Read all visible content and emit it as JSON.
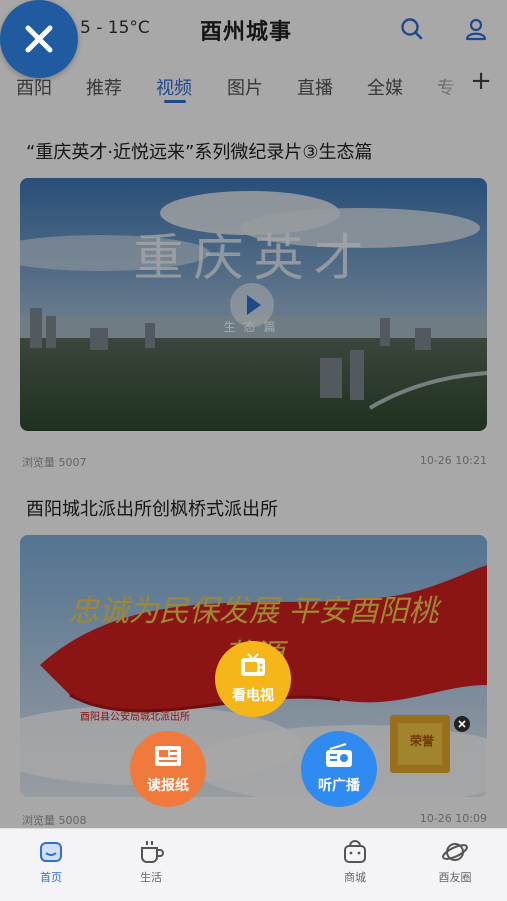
{
  "header": {
    "weather": "5 - 15°C",
    "title": "酉州城事"
  },
  "tabs": [
    {
      "label": "酉阳"
    },
    {
      "label": "推荐"
    },
    {
      "label": "视频"
    },
    {
      "label": "图片"
    },
    {
      "label": "直播"
    },
    {
      "label": "全媒"
    },
    {
      "label": "专"
    }
  ],
  "articles": [
    {
      "title": "“重庆英才·近悦远来”系列微纪录片③生态篇",
      "image_text": "重庆英才",
      "image_subtext": "生态篇",
      "views": "浏览量 5007",
      "time": "10-26 10:21"
    },
    {
      "title": "酉阳城北派出所创枫桥式派出所",
      "image_text": "忠诚为民保发展 平安酉阳桃花源",
      "image_caption": "酉阳县公安局城北派出所",
      "stamp": "荣誉",
      "views": "浏览量 5008",
      "time": "10-26 10:09"
    }
  ],
  "float_menu": {
    "tv": "看电视",
    "newspaper": "读报纸",
    "radio": "听广播"
  },
  "bottom_nav": [
    {
      "label": "首页"
    },
    {
      "label": "生活"
    },
    {
      "label": "商城"
    },
    {
      "label": "酉友圈"
    }
  ],
  "colors": {
    "accent": "#2f6fd6",
    "fab_orange": "#f07a3c",
    "fab_yellow": "#f5b619",
    "fab_blue": "#2f8bf0"
  }
}
